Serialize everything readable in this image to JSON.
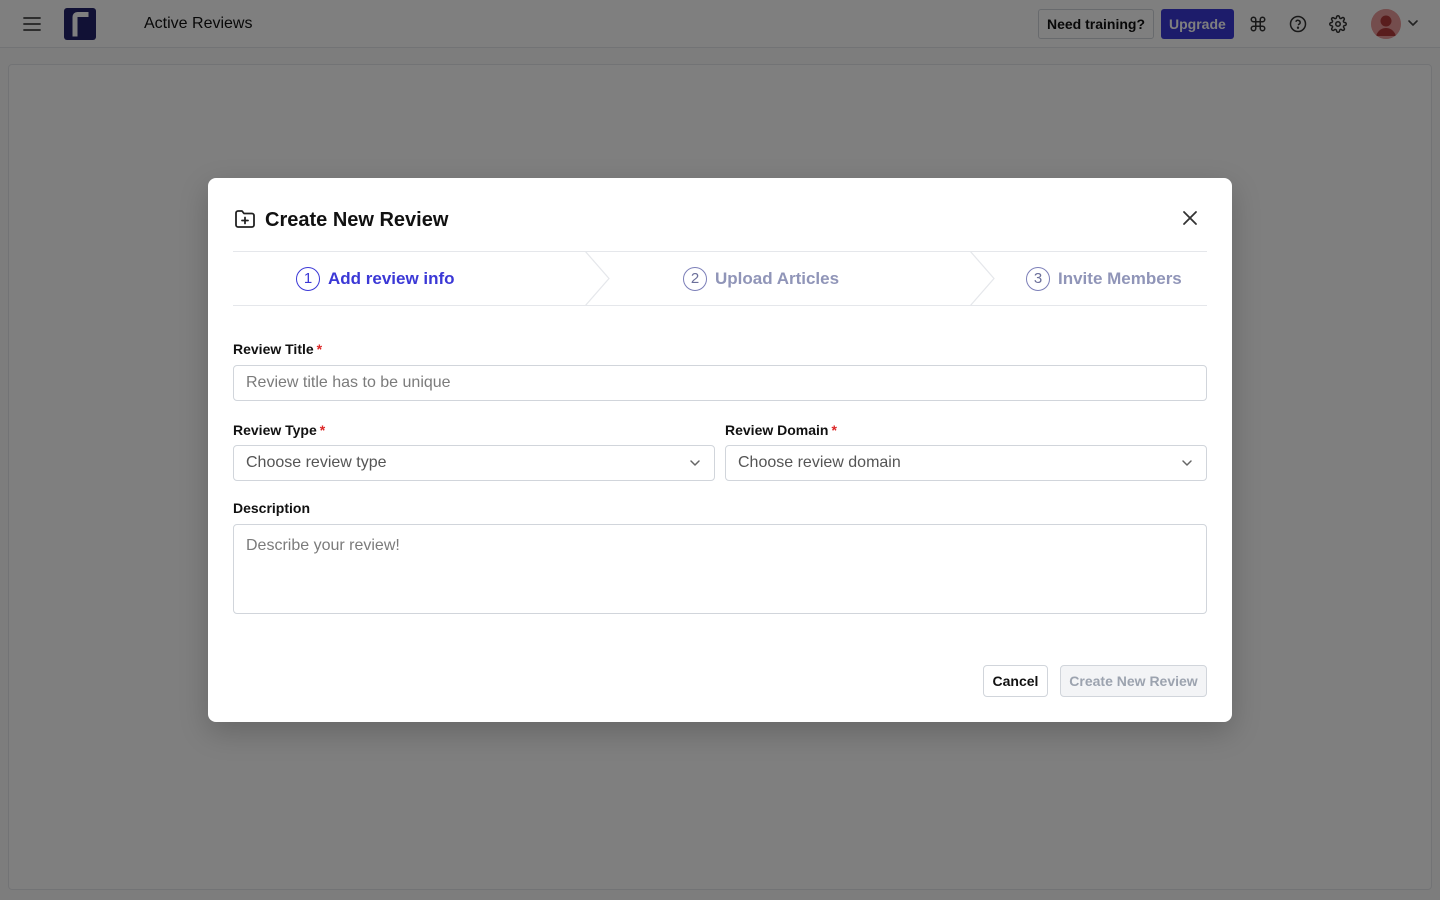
{
  "topbar": {
    "title": "Active Reviews",
    "training_label": "Need training?",
    "upgrade_label": "Upgrade",
    "icons": [
      "menu-icon",
      "command-icon",
      "help-icon",
      "settings-icon",
      "avatar",
      "chevron-down-icon"
    ]
  },
  "modal": {
    "title": "Create New Review",
    "steps": [
      {
        "number": "1",
        "label": "Add review info",
        "active": true
      },
      {
        "number": "2",
        "label": "Upload Articles",
        "active": false
      },
      {
        "number": "3",
        "label": "Invite Members",
        "active": false
      }
    ],
    "fields": {
      "title_label": "Review Title",
      "title_placeholder": "Review title has to be unique",
      "type_label": "Review Type",
      "type_placeholder": "Choose review type",
      "domain_label": "Review Domain",
      "domain_placeholder": "Choose review domain",
      "description_label": "Description",
      "description_placeholder": "Describe your review!",
      "required_mark": "*"
    },
    "cancel_label": "Cancel",
    "create_label": "Create New Review"
  },
  "colors": {
    "accent": "#3b38d6",
    "logo": "#23236a",
    "required": "#dc2626"
  }
}
